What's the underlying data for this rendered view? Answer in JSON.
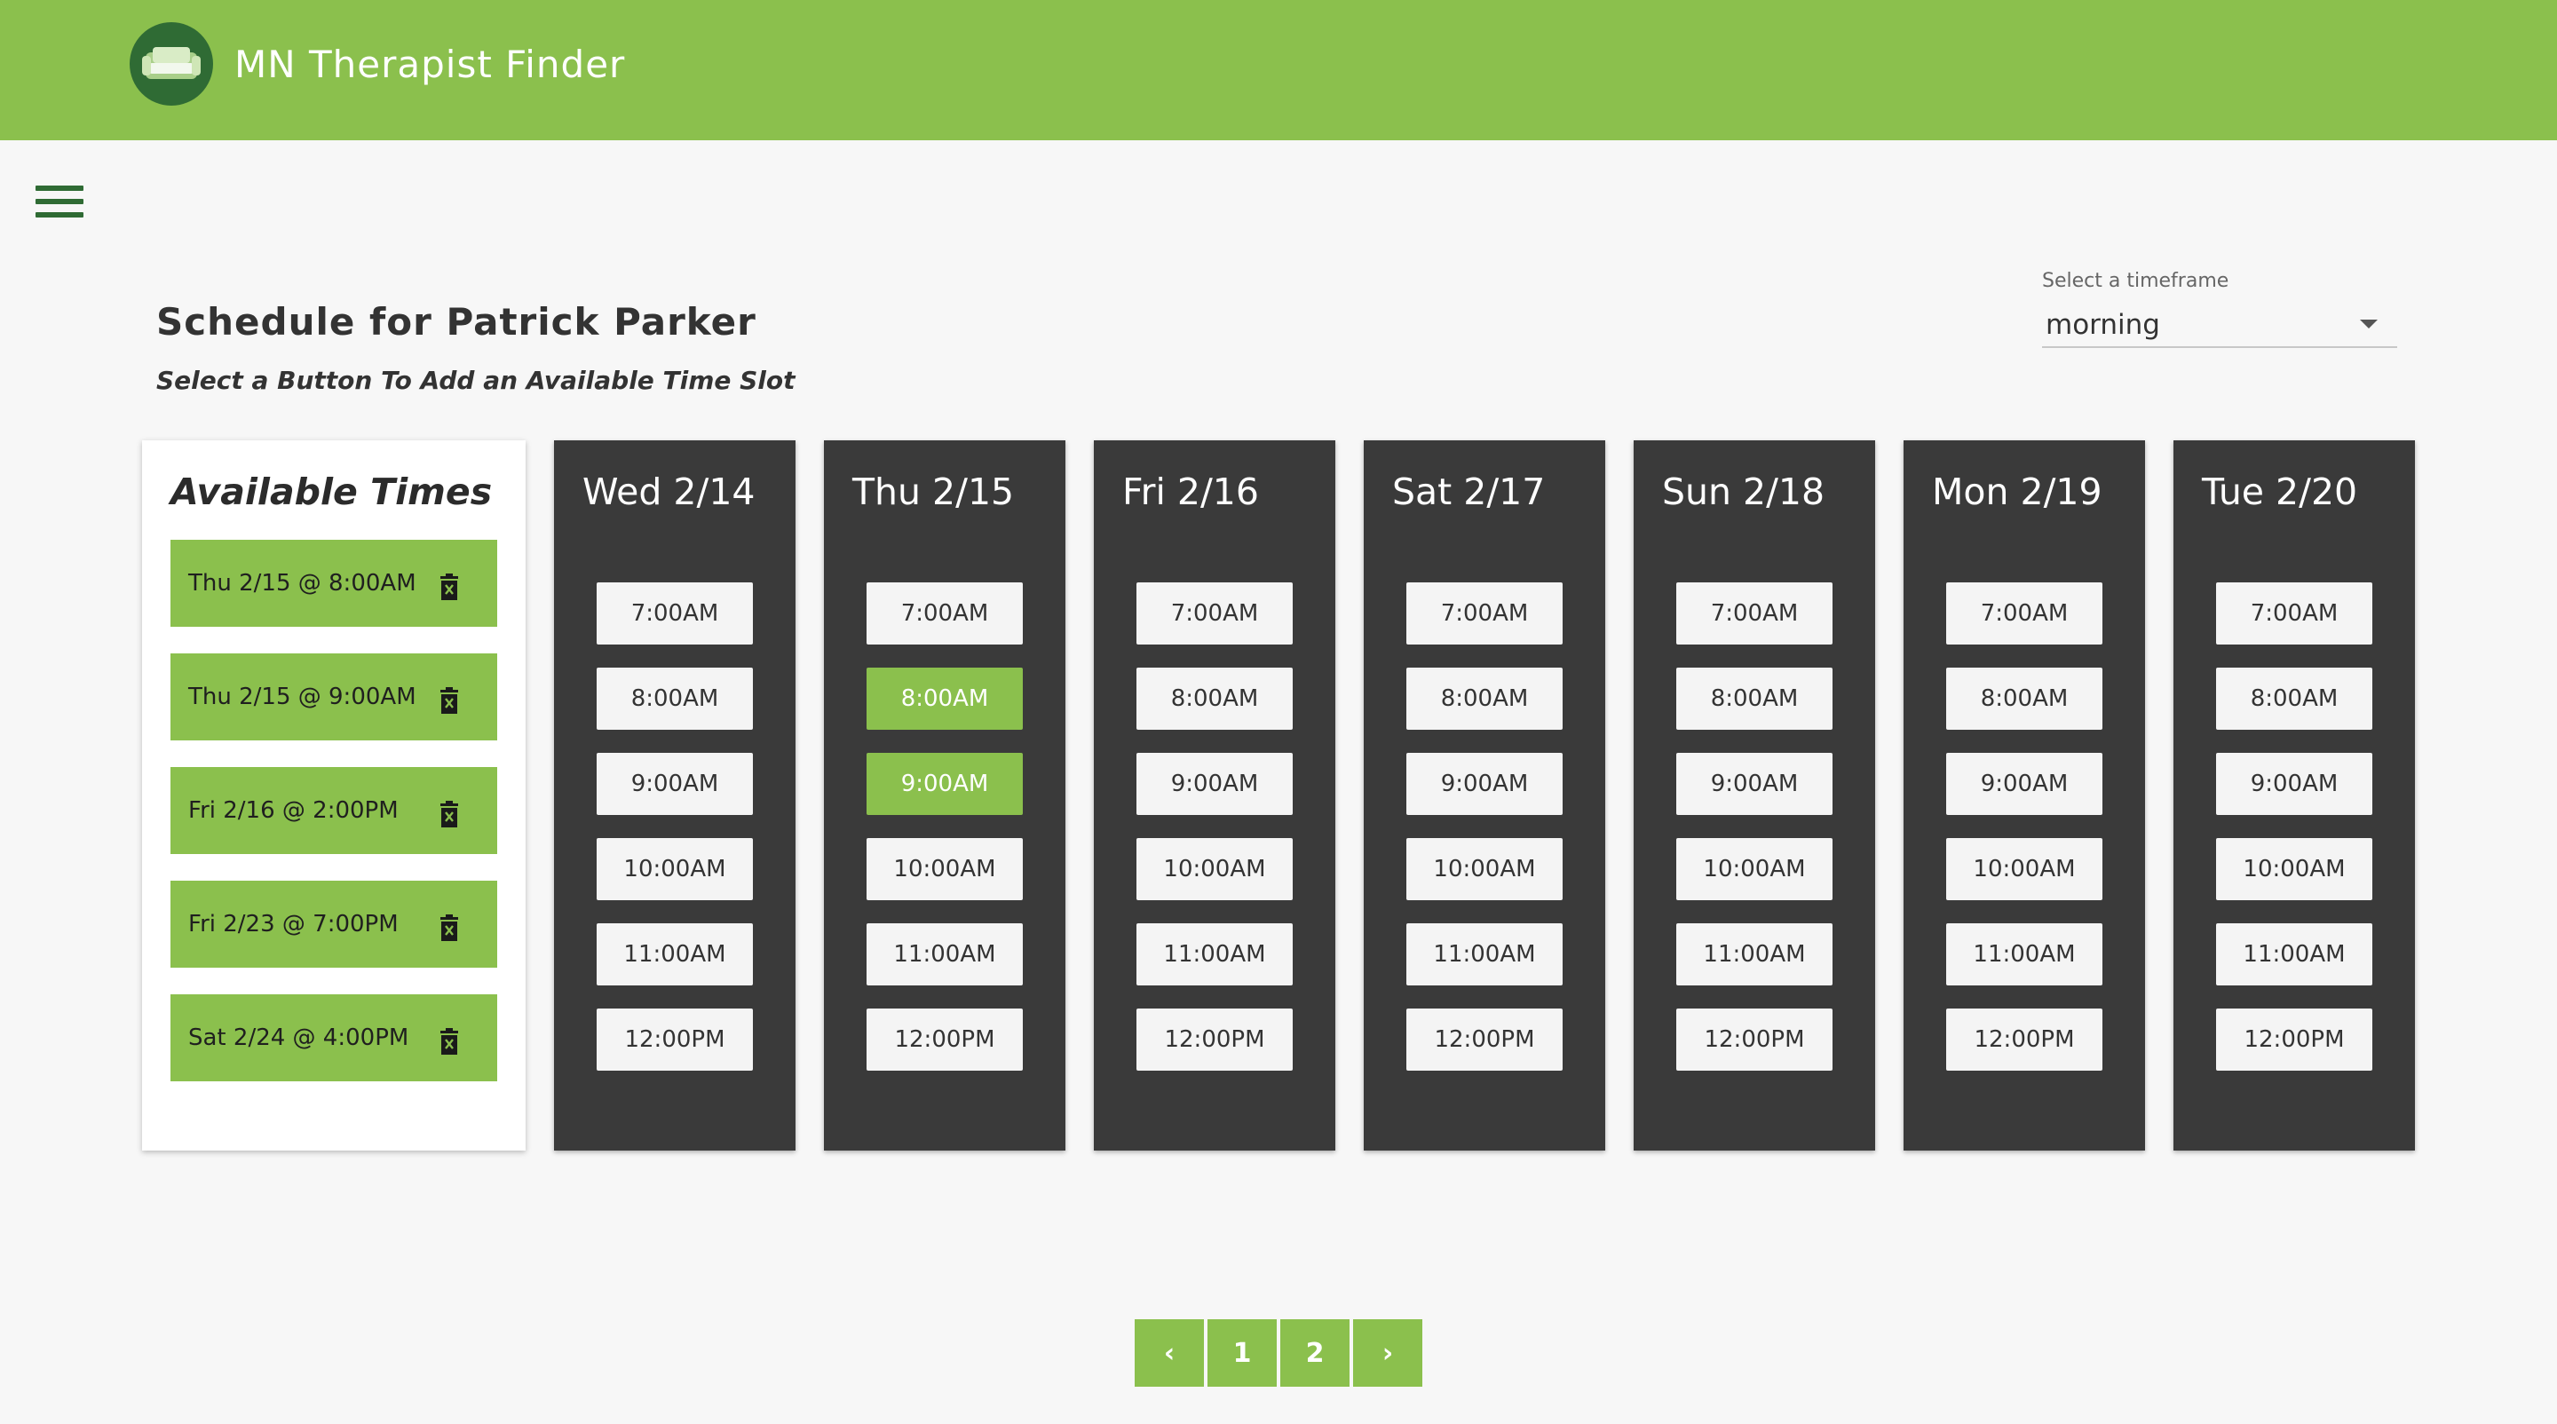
{
  "header": {
    "app_title": "MN Therapist Finder",
    "logo_icon": "couch-icon",
    "brand_color": "#8bc04d",
    "logo_color": "#2f6b34"
  },
  "nav": {
    "menu_icon": "hamburger-menu-icon"
  },
  "schedule": {
    "title": "Schedule for Patrick Parker",
    "subtitle": "Select a Button To Add an Available Time Slot"
  },
  "timeframe": {
    "label": "Select a timeframe",
    "selected": "morning"
  },
  "available": {
    "title": "Available Times",
    "items": [
      "Thu 2/15 @ 8:00AM",
      "Thu 2/15 @ 9:00AM",
      "Fri 2/16 @ 2:00PM",
      "Fri 2/23 @ 7:00PM",
      "Sat 2/24 @ 4:00PM"
    ],
    "delete_icon": "trash-icon"
  },
  "days": [
    {
      "label": "Wed 2/14",
      "slots": [
        "7:00AM",
        "8:00AM",
        "9:00AM",
        "10:00AM",
        "11:00AM",
        "12:00PM"
      ],
      "selected": []
    },
    {
      "label": "Thu 2/15",
      "slots": [
        "7:00AM",
        "8:00AM",
        "9:00AM",
        "10:00AM",
        "11:00AM",
        "12:00PM"
      ],
      "selected": [
        "8:00AM",
        "9:00AM"
      ]
    },
    {
      "label": "Fri 2/16",
      "slots": [
        "7:00AM",
        "8:00AM",
        "9:00AM",
        "10:00AM",
        "11:00AM",
        "12:00PM"
      ],
      "selected": []
    },
    {
      "label": "Sat 2/17",
      "slots": [
        "7:00AM",
        "8:00AM",
        "9:00AM",
        "10:00AM",
        "11:00AM",
        "12:00PM"
      ],
      "selected": []
    },
    {
      "label": "Sun 2/18",
      "slots": [
        "7:00AM",
        "8:00AM",
        "9:00AM",
        "10:00AM",
        "11:00AM",
        "12:00PM"
      ],
      "selected": []
    },
    {
      "label": "Mon 2/19",
      "slots": [
        "7:00AM",
        "8:00AM",
        "9:00AM",
        "10:00AM",
        "11:00AM",
        "12:00PM"
      ],
      "selected": []
    },
    {
      "label": "Tue 2/20",
      "slots": [
        "7:00AM",
        "8:00AM",
        "9:00AM",
        "10:00AM",
        "11:00AM",
        "12:00PM"
      ],
      "selected": []
    }
  ],
  "pagination": {
    "prev": "‹",
    "pages": [
      "1",
      "2"
    ],
    "next": "›"
  }
}
